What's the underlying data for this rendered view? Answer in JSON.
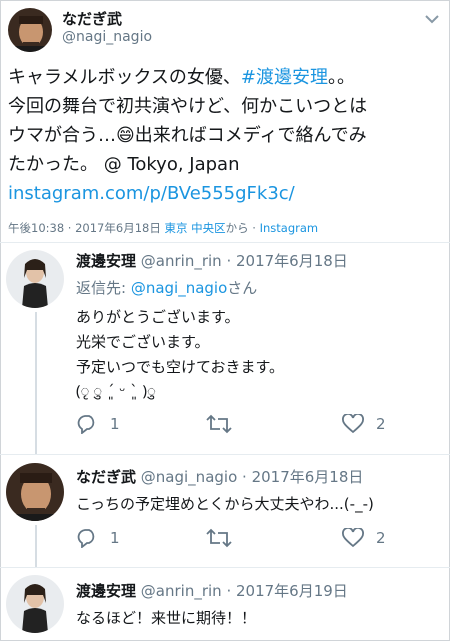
{
  "main_tweet": {
    "display_name": "なだぎ武",
    "handle": "@nagi_nagio",
    "text_line1_prefix": "キャラメルボックスの女優、",
    "text_line1_hashtag": "#渡邊安理",
    "text_line1_suffix": "。。",
    "text_line2": "今回の舞台で初共演やけど、何かこいつとは",
    "text_line3_prefix": "ウマが合う…",
    "text_line3_emoji": "😄",
    "text_line3_suffix": "出来ればコメディで絡んでみ",
    "text_line4_prefix": "たかった。 @ Tokyo, Japan",
    "link": "instagram.com/p/BVe555gFk3c/",
    "meta_time": "午後10:38 · 2017年6月18日",
    "meta_location": "東京 中央区",
    "meta_from": "から · ",
    "meta_source": "Instagram"
  },
  "replies": [
    {
      "display_name": "渡邊安理",
      "handle": "@anrin_rin",
      "date": "· 2017年6月18日",
      "reply_to_label": "返信先: ",
      "reply_to_handle": "@nagi_nagio",
      "reply_to_suffix": "さん",
      "lines": [
        "ありがとうございます。",
        "光栄でございます。",
        "予定いつでも空けておきます。",
        "(ृ ु ´͈ ᵕ `͈ )ु"
      ],
      "reply_count": "1",
      "like_count": "2"
    },
    {
      "display_name": "なだぎ武",
      "handle": "@nagi_nagio",
      "date": "· 2017年6月18日",
      "lines": [
        "こっちの予定埋めとくから大丈夫やわ...(-_-)"
      ],
      "reply_count": "1",
      "like_count": "2"
    },
    {
      "display_name": "渡邊安理",
      "handle": "@anrin_rin",
      "date": "· 2017年6月19日",
      "lines": [
        "なるほど！来世に期待！！"
      ]
    }
  ],
  "icons": {
    "menu": "chevron-down-icon",
    "reply": "reply-icon",
    "retweet": "retweet-icon",
    "like": "heart-icon"
  },
  "colors": {
    "link": "#1b95e0",
    "muted": "#657786",
    "text": "#14171a"
  }
}
